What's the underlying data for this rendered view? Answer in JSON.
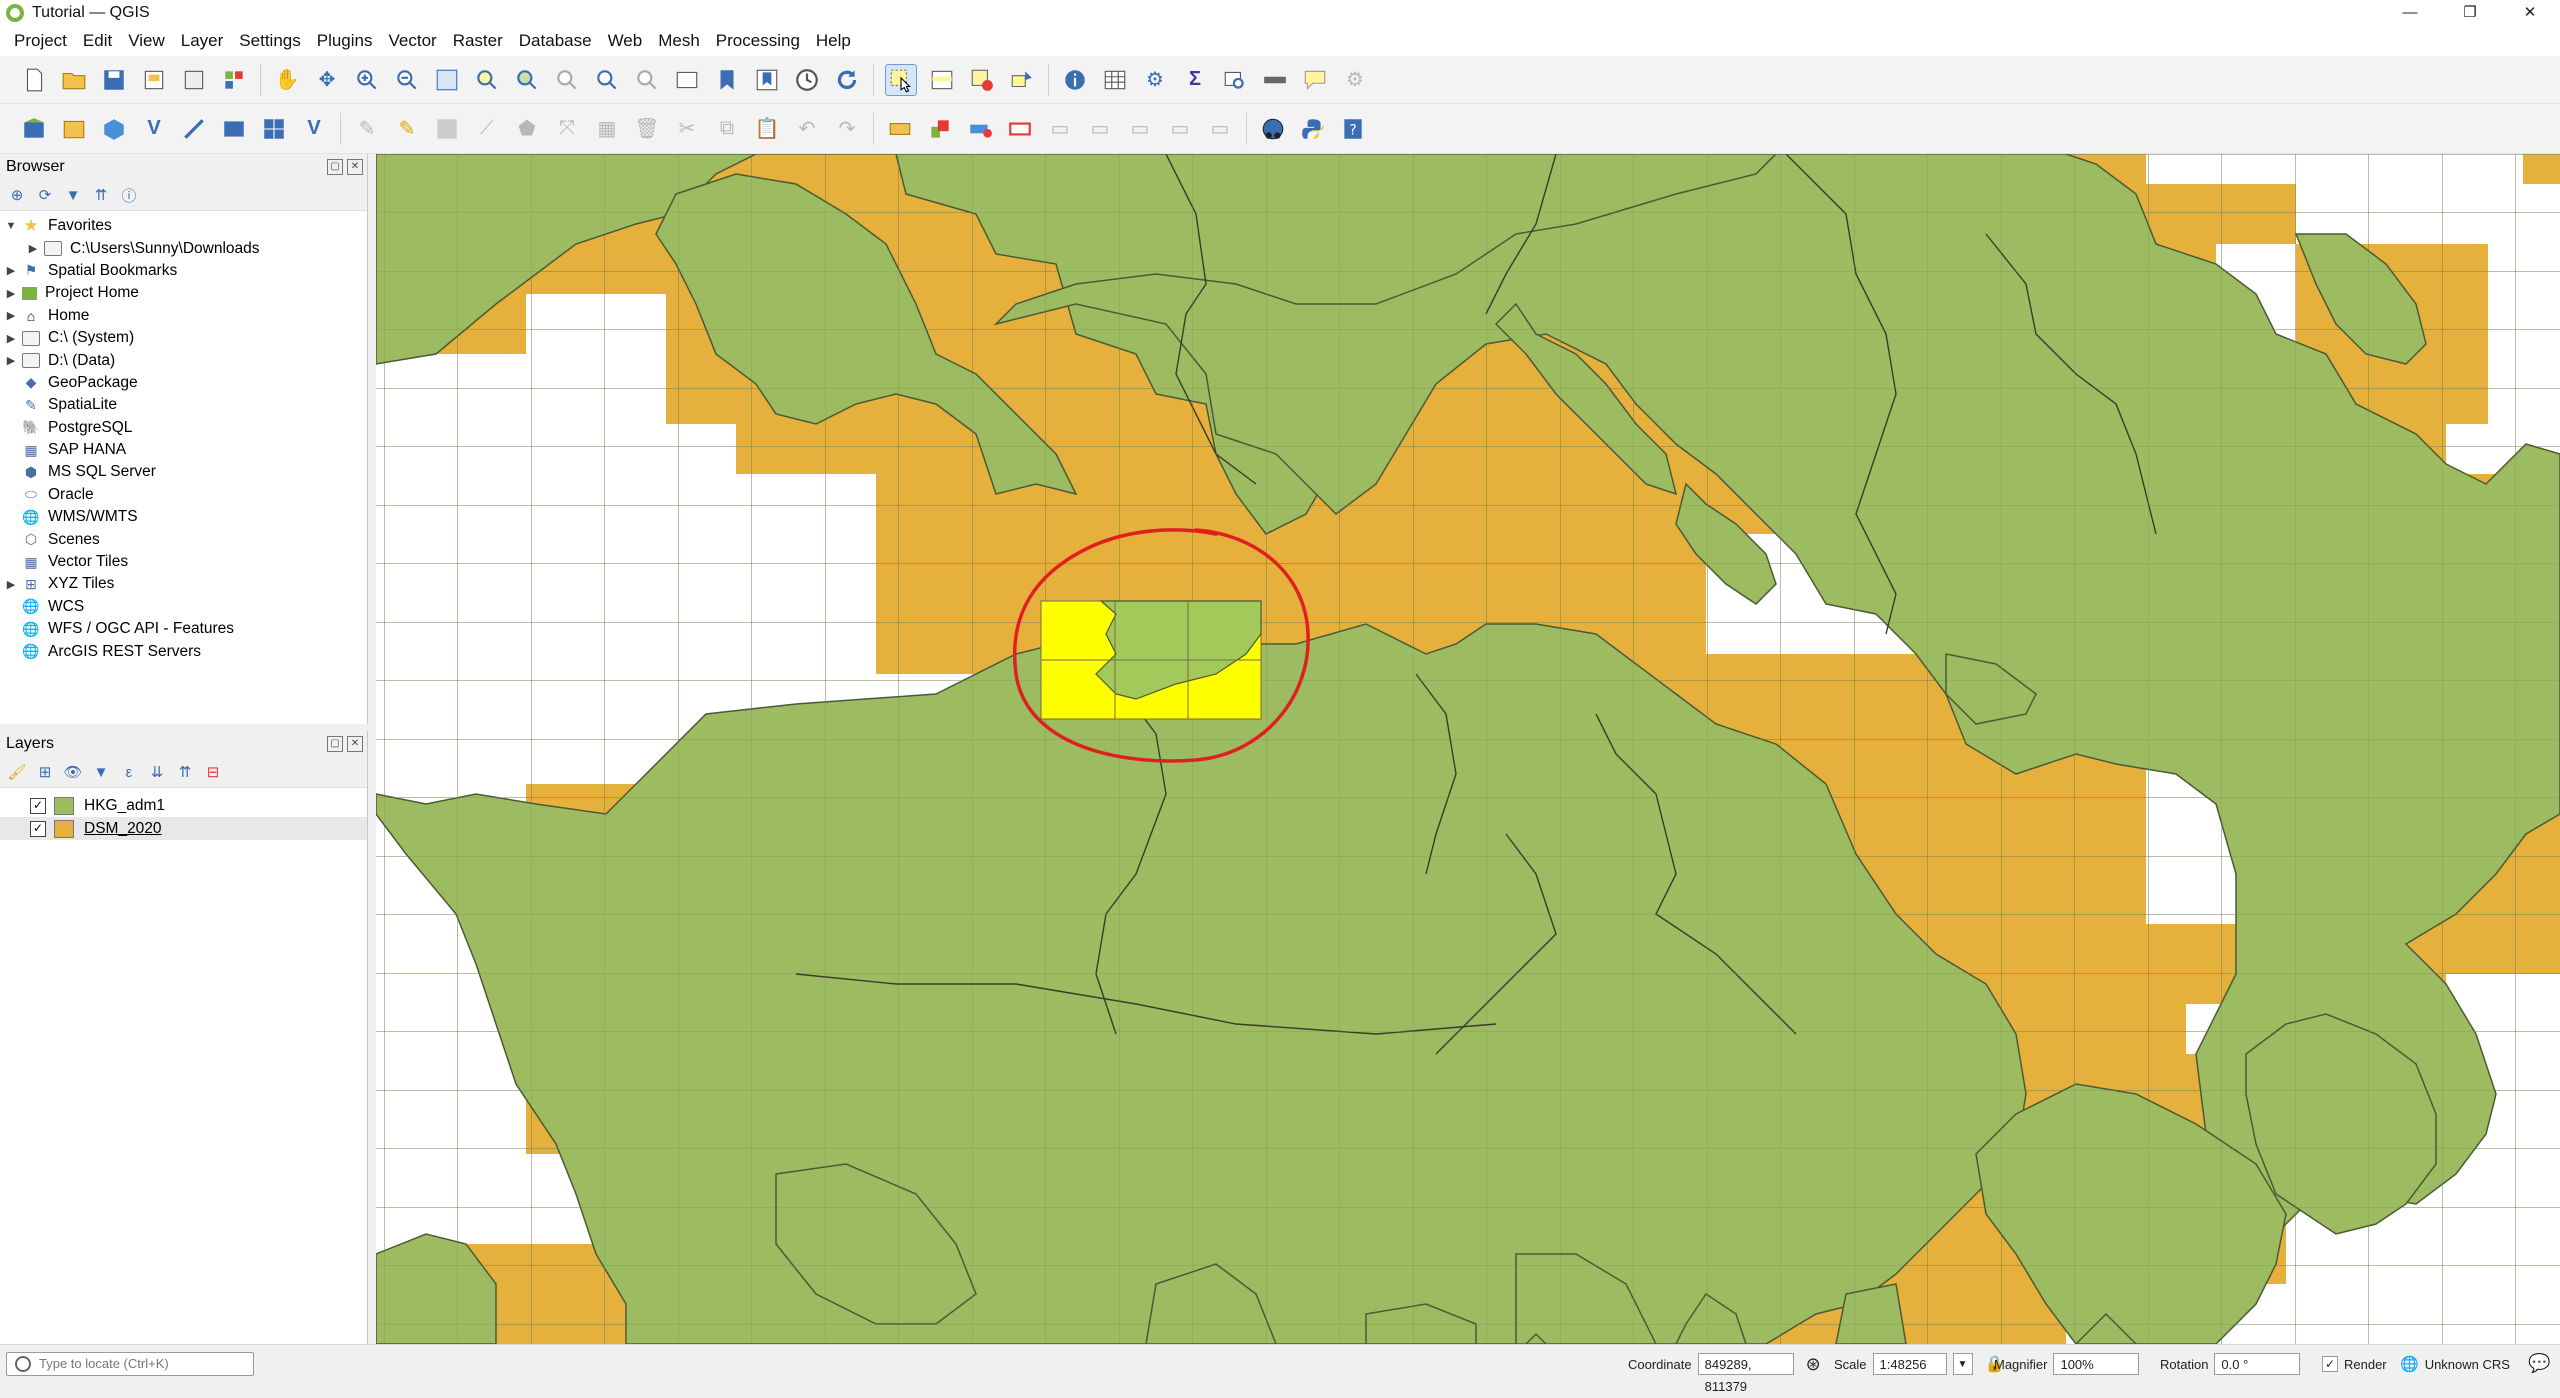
{
  "window": {
    "title": "Tutorial — QGIS",
    "minimize": "—",
    "maximize": "❐",
    "close": "✕"
  },
  "menu": [
    "Project",
    "Edit",
    "View",
    "Layer",
    "Settings",
    "Plugins",
    "Vector",
    "Raster",
    "Database",
    "Web",
    "Mesh",
    "Processing",
    "Help"
  ],
  "browser": {
    "title": "Browser",
    "items": [
      {
        "label": "Favorites",
        "icon": "star-icon",
        "expanded": true
      },
      {
        "label": "C:\\Users\\Sunny\\Downloads",
        "icon": "folder-icon",
        "child": true
      },
      {
        "label": "Spatial Bookmarks",
        "icon": "bookmark-icon"
      },
      {
        "label": "Project Home",
        "icon": "project-home-icon"
      },
      {
        "label": "Home",
        "icon": "home-icon"
      },
      {
        "label": "C:\\ (System)",
        "icon": "drive-icon"
      },
      {
        "label": "D:\\ (Data)",
        "icon": "drive-icon"
      },
      {
        "label": "GeoPackage",
        "icon": "geopackage-icon"
      },
      {
        "label": "SpatiaLite",
        "icon": "spatialite-icon"
      },
      {
        "label": "PostgreSQL",
        "icon": "postgresql-icon"
      },
      {
        "label": "SAP HANA",
        "icon": "sap-hana-icon"
      },
      {
        "label": "MS SQL Server",
        "icon": "mssql-icon"
      },
      {
        "label": "Oracle",
        "icon": "oracle-icon"
      },
      {
        "label": "WMS/WMTS",
        "icon": "wms-icon"
      },
      {
        "label": "Scenes",
        "icon": "scenes-icon"
      },
      {
        "label": "Vector Tiles",
        "icon": "vector-tiles-icon"
      },
      {
        "label": "XYZ Tiles",
        "icon": "xyz-tiles-icon"
      },
      {
        "label": "WCS",
        "icon": "wcs-icon"
      },
      {
        "label": "WFS / OGC API - Features",
        "icon": "wfs-icon"
      },
      {
        "label": "ArcGIS REST Servers",
        "icon": "arcgis-icon"
      }
    ]
  },
  "layers": {
    "title": "Layers",
    "items": [
      {
        "name": "HKG_adm1",
        "checked": true,
        "color": "#9dbb61"
      },
      {
        "name": "DSM_2020",
        "checked": true,
        "color": "#e6b03c"
      }
    ]
  },
  "map": {
    "vector_color": "#9dbb61",
    "raster_color": "#e6b03c",
    "selection_color": "#ffff00",
    "annotation_color": "#e02020"
  },
  "statusbar": {
    "locator_placeholder": "Type to locate (Ctrl+K)",
    "coordinate_label": "Coordinate",
    "coordinate_value": "849289, 811379",
    "scale_label": "Scale",
    "scale_value": "1:48256",
    "magnifier_label": "Magnifier",
    "magnifier_value": "100%",
    "rotation_label": "Rotation",
    "rotation_value": "0.0 °",
    "render_label": "Render",
    "crs_label": "Unknown CRS"
  }
}
